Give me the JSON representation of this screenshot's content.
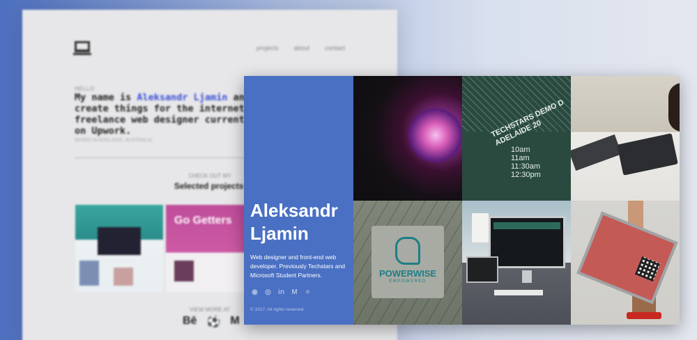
{
  "background_page": {
    "nav": [
      "projects",
      "about",
      "contact"
    ],
    "hello": "HELLO",
    "intro_prefix": "My name is ",
    "intro_name": "Aleksandr Ljamin",
    "intro_suffix": " and I\ncreate things for the internet. I'\nfreelance web designer currently\non Upwork.",
    "based": "BASED IN ADELAIDE, AUSTRALIA",
    "check_out": "CHECK OUT MY",
    "selected_projects": "Selected projects",
    "thumb2_text": "Go Getters",
    "view_more": "VIEW MORE AT",
    "social": [
      "Bē",
      "⚽",
      "M"
    ]
  },
  "portfolio": {
    "first_name": "Aleksandr",
    "last_name": "Ljamin",
    "description": "Web designer and front-end web developer. Previously Techstars and Microsoft Student Partners.",
    "social_icons": [
      "github-icon",
      "dribbble-icon",
      "linkedin-icon",
      "medium-icon",
      "stack-icon"
    ],
    "social_glyphs": [
      "◉",
      "◎",
      "in",
      "M",
      "≡"
    ],
    "copyright": "© 2017. All rights reserved.",
    "tiles": {
      "techstars_title": "TECHSTARS DEMO D\nADELAIDE 20",
      "techstars_times": "10am\n11am\n11:30am\n12:30pm",
      "powerwise": "POWERWISE",
      "empowered": "EMPOWERED"
    }
  },
  "colors": {
    "panel_blue": "#4a70c3",
    "link_blue": "#3b4fd6",
    "powerwise_teal": "#1f7d86"
  }
}
